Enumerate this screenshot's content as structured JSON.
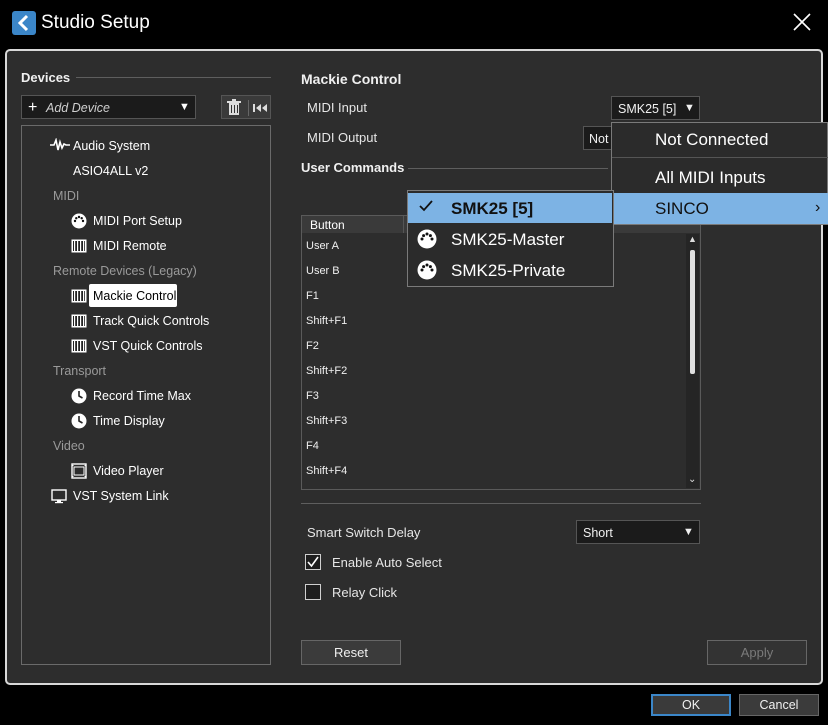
{
  "window": {
    "title": "Studio Setup"
  },
  "devices_panel": {
    "header": "Devices",
    "add_device": "Add Device",
    "tree": {
      "audio_system": "Audio System",
      "asio": "ASIO4ALL v2",
      "midi_cat": "MIDI",
      "midi_port_setup": "MIDI Port Setup",
      "midi_remote": "MIDI Remote",
      "remote_cat": "Remote Devices (Legacy)",
      "mackie_control": "Mackie Control",
      "track_quick_controls": "Track Quick Controls",
      "vst_quick_controls": "VST Quick Controls",
      "transport_cat": "Transport",
      "record_time_max": "Record Time Max",
      "time_display": "Time Display",
      "video_cat": "Video",
      "video_player": "Video Player",
      "vst_system_link": "VST System Link"
    }
  },
  "settings": {
    "title": "Mackie Control",
    "midi_input_label": "MIDI Input",
    "midi_input_value": "SMK25 [5]",
    "midi_output_label": "MIDI Output",
    "midi_output_value": "Not",
    "user_commands_label": "User Commands",
    "column_button": "Button",
    "rows": [
      "User A",
      "User B",
      "F1",
      "Shift+F1",
      "F2",
      "Shift+F2",
      "F3",
      "Shift+F3",
      "F4",
      "Shift+F4"
    ],
    "smart_switch_delay_label": "Smart Switch Delay",
    "smart_switch_delay_value": "Short",
    "enable_auto_select": "Enable Auto Select",
    "enable_auto_select_checked": true,
    "relay_click": "Relay Click",
    "relay_click_checked": false,
    "reset": "Reset",
    "apply": "Apply"
  },
  "dialog_buttons": {
    "ok": "OK",
    "cancel": "Cancel"
  },
  "midi_input_menu": {
    "items": [
      "Not Connected",
      "All MIDI Inputs",
      "SINCO"
    ],
    "submenu": [
      "SMK25 [5]",
      "SMK25-Master",
      "SMK25-Private"
    ],
    "submenu_selected": "SMK25 [5]"
  },
  "colors": {
    "accent": "#3b86c8",
    "highlight": "#7db3e4",
    "background": "#2d2d2d"
  }
}
